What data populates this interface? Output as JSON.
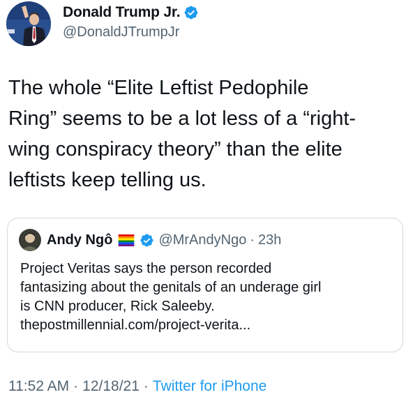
{
  "author": {
    "display_name": "Donald Trump Jr.",
    "handle": "@DonaldJTrumpJr",
    "verified": true
  },
  "tweet": {
    "text": "The whole “Elite Leftist Pedophile\nRing” seems to be a lot less of a “right-\nwing conspiracy theory” than the elite\nleftists keep telling us."
  },
  "quoted_tweet": {
    "display_name": "Andy Ngô",
    "flag_icon": "rainbow-flag-icon",
    "verified": true,
    "handle": "@MrAndyNgo",
    "separator": "·",
    "time": "23h",
    "text": "Project Veritas says the person recorded\nfantasizing about the genitals of an underage girl\nis CNN producer, Rick Saleeby.\nthepostmillennial.com/project-verita..."
  },
  "meta": {
    "time": "11:52 AM",
    "separator": "·",
    "date": "12/18/21",
    "separator_2": "·",
    "source": "Twitter for iPhone"
  },
  "colors": {
    "verified_blue": "#1d9bf0",
    "text_primary": "#0f1419",
    "text_secondary": "#536471",
    "link": "#1d9bf0",
    "border": "#cfd9de"
  }
}
